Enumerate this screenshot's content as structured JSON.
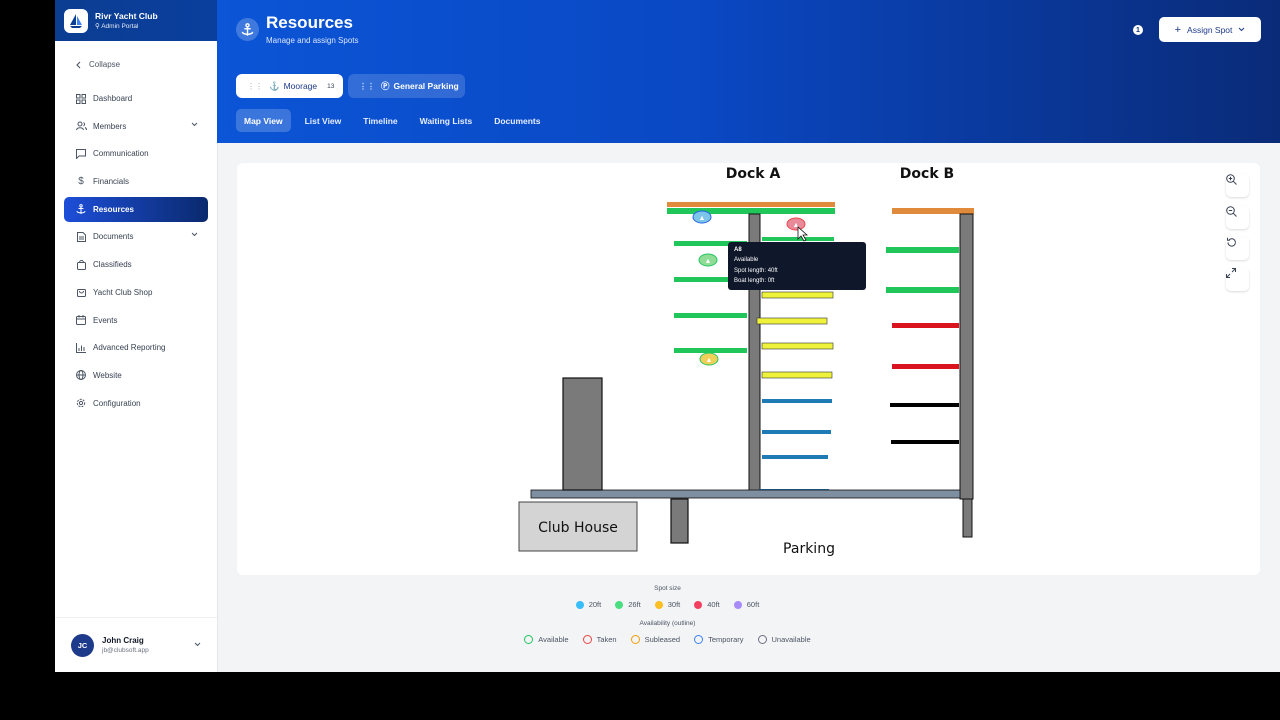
{
  "brand": {
    "name": "Rivr Yacht Club",
    "subtitle": "Admin Portal"
  },
  "sidebar": {
    "collapse_label": "Collapse",
    "items": [
      {
        "label": "Dashboard",
        "icon": "dashboard-icon"
      },
      {
        "label": "Members",
        "icon": "users-icon",
        "expandable": true
      },
      {
        "label": "Communication",
        "icon": "chat-icon"
      },
      {
        "label": "Financials",
        "icon": "dollar-icon"
      },
      {
        "label": "Resources",
        "icon": "anchor-icon",
        "active": true
      },
      {
        "label": "Documents",
        "icon": "document-icon",
        "expandable": true
      },
      {
        "label": "Classifieds",
        "icon": "bag-icon"
      },
      {
        "label": "Yacht Club Shop",
        "icon": "shop-icon"
      },
      {
        "label": "Events",
        "icon": "calendar-icon"
      },
      {
        "label": "Advanced Reporting",
        "icon": "chart-icon"
      },
      {
        "label": "Website",
        "icon": "globe-icon"
      },
      {
        "label": "Configuration",
        "icon": "gear-icon"
      }
    ]
  },
  "user": {
    "initials": "JC",
    "name": "John Craig",
    "email": "jb@clubsoft.app"
  },
  "header": {
    "title": "Resources",
    "subtitle": "Manage and assign Spots",
    "notification_count": "1",
    "assign_label": "Assign Spot"
  },
  "resource_tabs": {
    "moorage_label": "Moorage",
    "moorage_count": "13",
    "parking_label": "General Parking"
  },
  "view_tabs": [
    "Map View",
    "List View",
    "Timeline",
    "Waiting Lists",
    "Documents"
  ],
  "map": {
    "dock_a_label": "Dock A",
    "dock_b_label": "Dock B",
    "club_house_label": "Club House",
    "parking_label": "Parking",
    "tooltip": {
      "spot": "A8",
      "status": "Available",
      "spot_length": "Spot length: 40ft",
      "boat_length": "Boat length: 0ft"
    }
  },
  "legend": {
    "size_title": "Spot size",
    "sizes": [
      {
        "label": "20ft",
        "color": "#38bdf8"
      },
      {
        "label": "26ft",
        "color": "#4ade80"
      },
      {
        "label": "30ft",
        "color": "#fbbf24"
      },
      {
        "label": "40ft",
        "color": "#f43f5e"
      },
      {
        "label": "60ft",
        "color": "#a78bfa"
      }
    ],
    "availability_title": "Availability (outline)",
    "availability": [
      {
        "label": "Available",
        "color": "#22c55e"
      },
      {
        "label": "Taken",
        "color": "#ef4444"
      },
      {
        "label": "Subleased",
        "color": "#f59e0b"
      },
      {
        "label": "Temporary",
        "color": "#3b82f6"
      },
      {
        "label": "Unavailable",
        "color": "#6b7280"
      }
    ]
  },
  "colors": {
    "accent": "#0b55d6",
    "header_dark": "#0a2b78"
  }
}
